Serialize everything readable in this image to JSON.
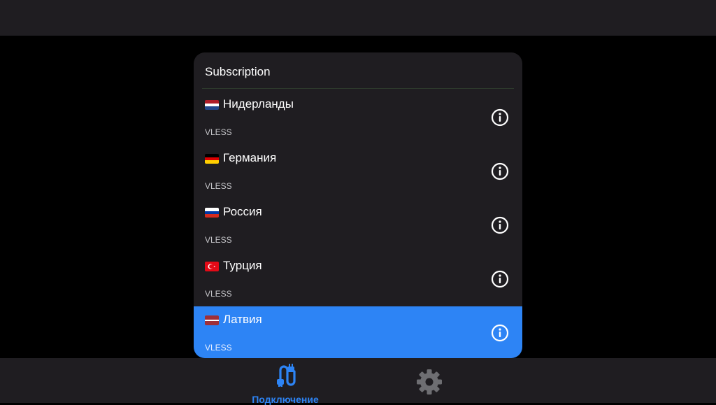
{
  "dialog": {
    "title": "Subscription",
    "servers": [
      {
        "name": "Нидерланды",
        "protocol": "VLESS",
        "flag": "netherlands-flag-icon",
        "flag_colors": [
          "#ae1c28",
          "#ffffff",
          "#21468b"
        ],
        "selected": false
      },
      {
        "name": "Германия",
        "protocol": "VLESS",
        "flag": "germany-flag-icon",
        "flag_colors": [
          "#000000",
          "#dd0000",
          "#ffce00"
        ],
        "selected": false
      },
      {
        "name": "Россия",
        "protocol": "VLESS",
        "flag": "russia-flag-icon",
        "flag_colors": [
          "#ffffff",
          "#0039a6",
          "#d52b1e"
        ],
        "selected": false
      },
      {
        "name": "Турция",
        "protocol": "VLESS",
        "flag": "turkey-flag-icon",
        "flag_colors": [
          "#e30a17"
        ],
        "selected": false
      },
      {
        "name": "Латвия",
        "protocol": "VLESS",
        "flag": "latvia-flag-icon",
        "flag_colors": [
          "#9e3039",
          "#ffffff",
          "#9e3039"
        ],
        "selected": true
      }
    ],
    "info_icon": "info-icon"
  },
  "bottom_nav": {
    "connection_label": "Подключение",
    "connection_icon": "cable-connection-icon",
    "settings_icon": "gear-icon"
  },
  "colors": {
    "background": "#000000",
    "surface": "#1f1d21",
    "accent": "#2d84f5",
    "settings_icon": "#6e6e72"
  }
}
